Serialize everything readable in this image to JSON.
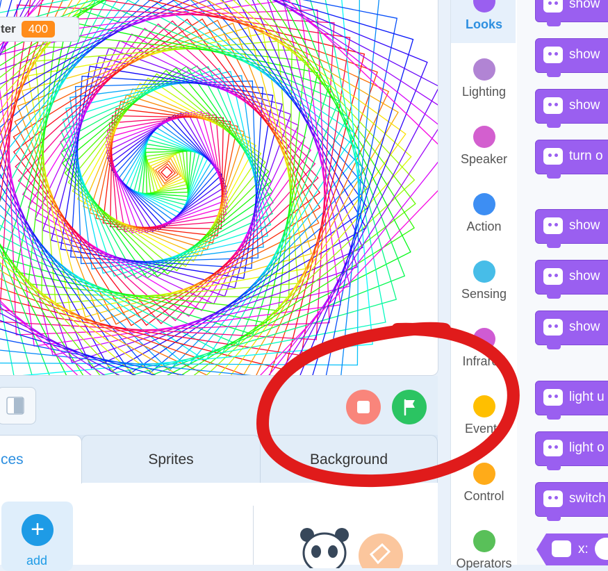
{
  "stage": {
    "monitor": {
      "label": "ter",
      "value": "400"
    }
  },
  "controls": {
    "stop_icon": "stop-icon",
    "go_icon": "green-flag-icon"
  },
  "tabs": [
    {
      "label": "ces",
      "active": true
    },
    {
      "label": "Sprites",
      "active": false
    },
    {
      "label": "Background",
      "active": false
    }
  ],
  "lower_panel": {
    "add_symbol": "+",
    "add_label": "add"
  },
  "categories": [
    {
      "label": "Looks",
      "color": "#9a5ff0",
      "active": true
    },
    {
      "label": "Lighting",
      "color": "#b184d4"
    },
    {
      "label": "Speaker",
      "color": "#d35fcf"
    },
    {
      "label": "Action",
      "color": "#3d8ef3"
    },
    {
      "label": "Sensing",
      "color": "#47bde8"
    },
    {
      "label": "Infrared",
      "color": "#cf5bd3"
    },
    {
      "label": "Events",
      "color": "#ffbf00"
    },
    {
      "label": "Control",
      "color": "#ffab19"
    },
    {
      "label": "Operators",
      "color": "#59c059"
    }
  ],
  "blocks": [
    {
      "text": "show"
    },
    {
      "text": "show"
    },
    {
      "text": "show"
    },
    {
      "text": "turn o"
    },
    {
      "text": "show"
    },
    {
      "text": "show"
    },
    {
      "text": "show"
    },
    {
      "text": "light u"
    },
    {
      "text": "light o"
    },
    {
      "text": "switch"
    }
  ],
  "xblock": {
    "label": "x:"
  },
  "colors": {
    "accent": "#2d8fe0",
    "block_purple": "#9a5ff0",
    "annotation_red": "#e01b1b"
  }
}
